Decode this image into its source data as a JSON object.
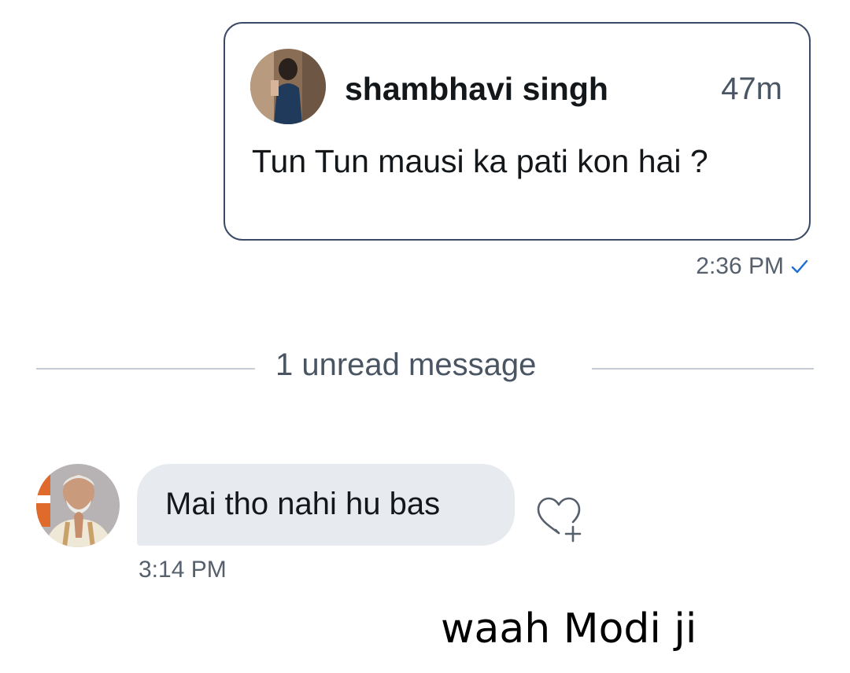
{
  "shared_tweet": {
    "author_name": "shambhavi singh",
    "relative_time": "47m",
    "text": "Tun Tun mausi ka pati kon hai ?"
  },
  "sent_message": {
    "time": "2:36 PM",
    "status_icon": "check-icon"
  },
  "divider": {
    "label": "1 unread message"
  },
  "received_message": {
    "text": "Mai tho nahi hu bas",
    "time": "3:14 PM",
    "reaction_icon": "heart-plus-icon"
  },
  "caption": "waah Modi ji",
  "colors": {
    "card_border": "#3b4a66",
    "bubble_bg": "#e7eaef",
    "muted_text": "#56606d",
    "check_blue": "#1d6fd6"
  }
}
